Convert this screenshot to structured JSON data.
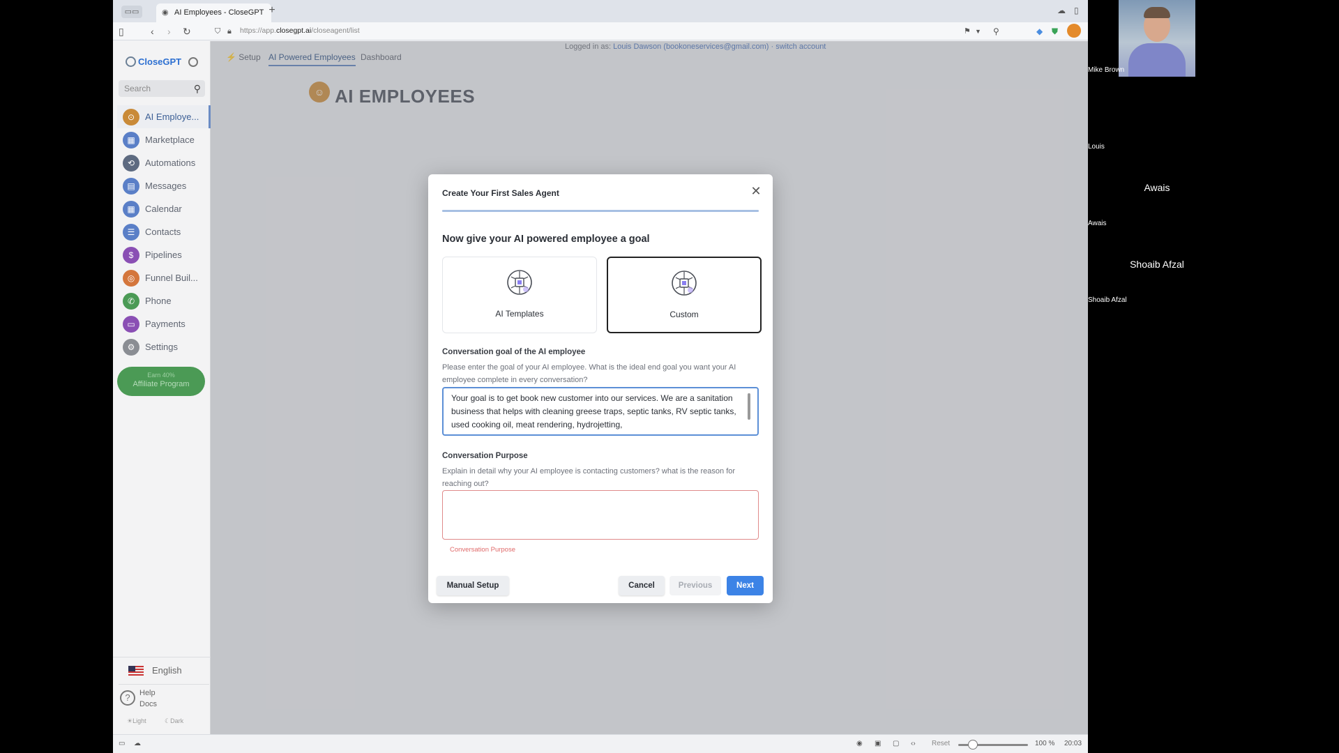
{
  "browser": {
    "tab_title": "AI Employees - CloseGPT",
    "url_prefix": "https://app.",
    "url_domain": "closegpt.ai",
    "url_path": "/closeagent/list"
  },
  "sidebar": {
    "logo": "CloseGPT",
    "search_placeholder": "Search",
    "items": [
      {
        "label": "AI Employe...",
        "icon": "robot-icon",
        "color": "#c98a38",
        "glyph": "⊙"
      },
      {
        "label": "Marketplace",
        "icon": "store-icon",
        "color": "#5a7fc7",
        "glyph": "▦"
      },
      {
        "label": "Automations",
        "icon": "automation-icon",
        "color": "#5d6a80",
        "glyph": "⟲"
      },
      {
        "label": "Messages",
        "icon": "chat-icon",
        "color": "#5a7fc7",
        "glyph": "▤"
      },
      {
        "label": "Calendar",
        "icon": "calendar-icon",
        "color": "#5a7fc7",
        "glyph": "▦"
      },
      {
        "label": "Contacts",
        "icon": "contacts-icon",
        "color": "#5a7fc7",
        "glyph": "☰"
      },
      {
        "label": "Pipelines",
        "icon": "dollar-icon",
        "color": "#8a4fb4",
        "glyph": "$"
      },
      {
        "label": "Funnel Buil...",
        "icon": "funnel-icon",
        "color": "#d4763c",
        "glyph": "◎"
      },
      {
        "label": "Phone",
        "icon": "phone-icon",
        "color": "#4b9a55",
        "glyph": "✆"
      },
      {
        "label": "Payments",
        "icon": "card-icon",
        "color": "#8a4fb4",
        "glyph": "▭"
      },
      {
        "label": "Settings",
        "icon": "gear-icon",
        "color": "#8a8d93",
        "glyph": "⚙"
      }
    ],
    "affiliate_top": "Earn 40%",
    "affiliate_label": "Affiliate Program",
    "language": "English",
    "help_line1": "Help",
    "help_line2": "Docs",
    "theme_light": "☀Light",
    "theme_dark": "☾Dark"
  },
  "topnav": {
    "setup": "Setup",
    "ai_employees": "AI Powered Employees",
    "dashboard": "Dashboard",
    "logged_in_prefix": "Logged in as: ",
    "logged_in_user": "Louis Dawson",
    "logged_in_extra": "(bookoneservices@gmail.com) · switch account"
  },
  "page": {
    "title": "AI EMPLOYEES"
  },
  "modal": {
    "title": "Create Your First Sales Agent",
    "progress_fraction": 1.0,
    "heading": "Now give your AI powered employee a goal",
    "options": [
      {
        "label": "AI Templates",
        "selected": false
      },
      {
        "label": "Custom",
        "selected": true
      }
    ],
    "goal_label": "Conversation goal of the AI employee",
    "goal_hint": "Please enter the goal of your AI employee. What is the ideal end goal you want your AI employee complete in every conversation?",
    "goal_value": "Your goal is to get book new customer into our services. We are a sanitation business that helps with cleaning greese traps, septic tanks, RV septic tanks, used cooking oil, meat rendering, hydrojetting,",
    "purpose_label": "Conversation Purpose",
    "purpose_hint": "Explain in detail why your AI employee is contacting customers? what is the reason for reaching out?",
    "purpose_value": "",
    "purpose_error": "Conversation Purpose",
    "buttons": {
      "manual": "Manual Setup",
      "cancel": "Cancel",
      "previous": "Previous",
      "next": "Next"
    }
  },
  "statusbar": {
    "reset": "Reset",
    "zoom": "100 %",
    "time": "20:03"
  },
  "call": {
    "participants": [
      {
        "name": "Mike Brown",
        "video": true
      },
      {
        "name": "Louis",
        "video": false,
        "center": ""
      },
      {
        "name": "Awais",
        "video": false,
        "center": "Awais"
      },
      {
        "name": "Shoaib Afzal",
        "video": false,
        "center": "Shoaib Afzal"
      }
    ]
  }
}
